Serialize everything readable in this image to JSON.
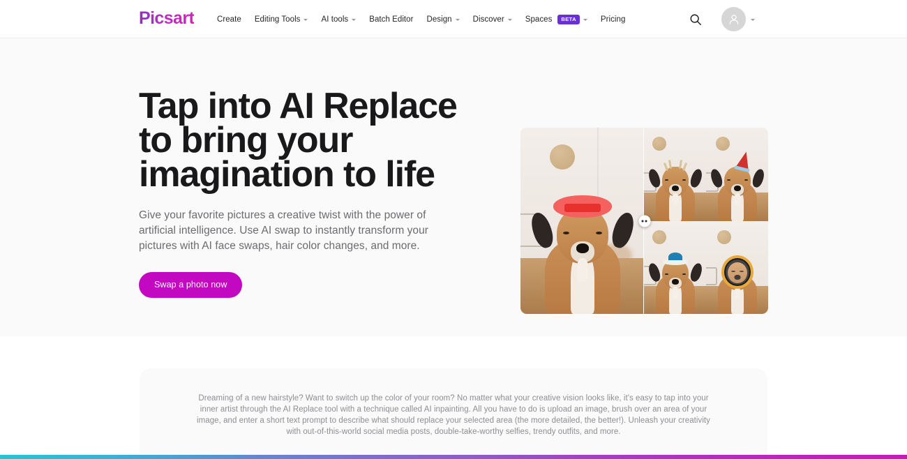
{
  "brand": {
    "logo_text": "Picsart",
    "logo_gradient_from": "#8b2fc9",
    "logo_gradient_to": "#d51ebd"
  },
  "header": {
    "nav_items": [
      {
        "label": "Create",
        "has_dropdown": false,
        "badge": null
      },
      {
        "label": "Editing Tools",
        "has_dropdown": true,
        "badge": null
      },
      {
        "label": "AI tools",
        "has_dropdown": true,
        "badge": null
      },
      {
        "label": "Batch Editor",
        "has_dropdown": false,
        "badge": null
      },
      {
        "label": "Design",
        "has_dropdown": true,
        "badge": null
      },
      {
        "label": "Discover",
        "has_dropdown": true,
        "badge": null
      },
      {
        "label": "Spaces",
        "has_dropdown": true,
        "badge": "BETA"
      },
      {
        "label": "Pricing",
        "has_dropdown": false,
        "badge": null
      }
    ],
    "search_icon": "search-icon",
    "avatar_icon": "user-avatar-icon",
    "avatar_chevron": "chevron-down-icon",
    "badge_color": "#6b2fd6"
  },
  "hero": {
    "title": "Tap into AI Replace to bring your imagination to life",
    "subtitle": "Give your favorite pictures a creative twist with the power of artificial intelligence. Use AI swap to instantly transform your pictures with AI face swaps, hair color changes, and more.",
    "cta_label": "Swap a photo now",
    "cta_color": "#c209c1",
    "background_color": "#fafafa",
    "comparison": {
      "handle_icon": "compare-slider-handle-icon",
      "before_label": "Original photo of dog with red crown",
      "after_variants": [
        "dog with antlers",
        "dog with party hat",
        "dog with blue cap",
        "dog with astronaut helmet"
      ]
    }
  },
  "info_card": {
    "paragraph": "Dreaming of a new hairstyle? Want to switch up the color of your room? No matter what your creative vision looks like, it's easy to tap into your inner artist through the AI Replace tool with a technique called AI inpainting. All you have to do is upload an image, brush over an area of your image, and enter a short text prompt to describe what should replace your selected area (the more detailed, the better!). Unleash your creativity with out-of-this-world social media posts, double-take-worthy selfies, trendy outfits, and more.",
    "background_color": "#fafafa"
  },
  "footer_bar": {
    "gradient_stops": [
      "#1ec8d4",
      "#5a8fd0",
      "#8f5cc8",
      "#c81abb"
    ]
  }
}
